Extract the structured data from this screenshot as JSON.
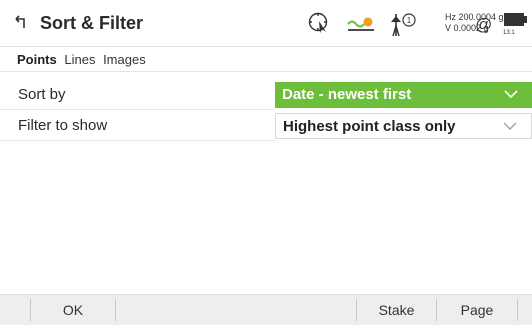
{
  "header": {
    "title": "Sort & Filter",
    "hz_line": "Hz 200.0004 g",
    "v_line": "V  0.0002 g",
    "at_symbol": "@",
    "battery_time": "13:1",
    "prism_number": "1",
    "icons": [
      "back-icon",
      "target-search-icon",
      "ppm-compensator-icon",
      "prism-icon",
      "at-icon",
      "battery-icon"
    ]
  },
  "subtabs": [
    {
      "label": "Points",
      "active": true
    },
    {
      "label": "Lines",
      "active": false
    },
    {
      "label": "Images",
      "active": false
    }
  ],
  "fields": {
    "sort_label": "Sort by",
    "sort_value": "Date - newest first",
    "filter_label": "Filter to show",
    "filter_value": "Highest point class only"
  },
  "softkeys": {
    "ok": "OK",
    "stake": "Stake",
    "page": "Page"
  },
  "colors": {
    "accent": "#6dbf3b",
    "compensator_dot": "#f0a020"
  }
}
